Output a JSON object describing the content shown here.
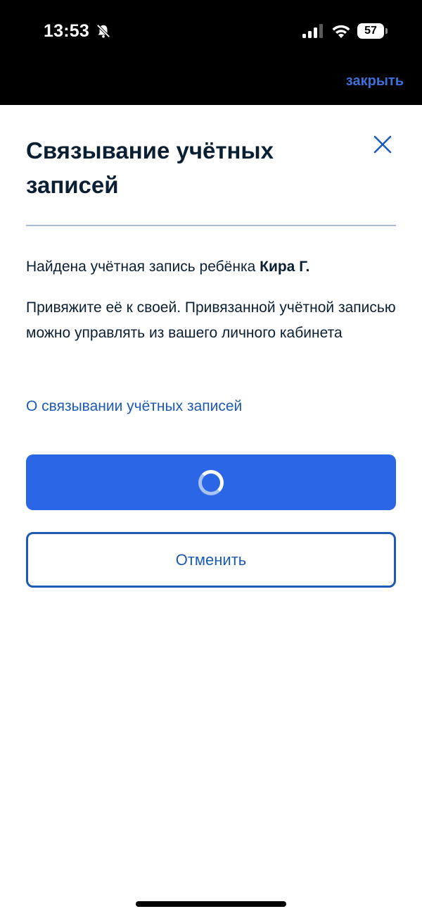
{
  "status_bar": {
    "time": "13:53",
    "battery_level": "57",
    "icons": [
      "bell-off-icon",
      "signal-icon",
      "wifi-icon",
      "battery-icon"
    ]
  },
  "top_bar": {
    "close_link": "закрыть"
  },
  "dialog": {
    "title": "Связывание учётных записей",
    "close_icon": "close-icon",
    "found_prefix": "Найдена учётная запись ребёнка ",
    "child_name": "Кира Г.",
    "description": "Привяжите её к своей. Привязанной учётной записью можно управлять из вашего личного кабинета",
    "info_link": "О связывании учётных записей",
    "primary_button_state": "loading",
    "cancel_label": "Отменить"
  },
  "colors": {
    "accent": "#2a66e6",
    "link": "#1d5ab4",
    "text": "#0b1f33",
    "divider": "#a9bce0"
  }
}
